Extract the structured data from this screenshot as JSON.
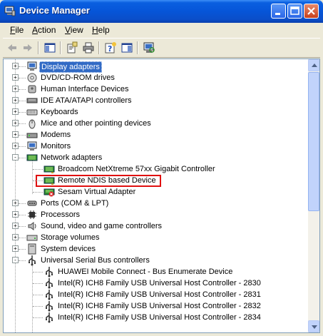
{
  "window": {
    "title": "Device Manager"
  },
  "menu": [
    {
      "label": "File",
      "u": "F",
      "rest": "ile"
    },
    {
      "label": "Action",
      "u": "A",
      "rest": "ction"
    },
    {
      "label": "View",
      "u": "V",
      "rest": "iew"
    },
    {
      "label": "Help",
      "u": "H",
      "rest": "elp"
    }
  ],
  "toolbar": {
    "icons": [
      "back-arrow-icon",
      "forward-arrow-icon",
      "show-hide-tree-icon",
      "properties-icon",
      "print-icon",
      "help-icon",
      "show-hide-action-pane-icon",
      "scan-hardware-icon"
    ]
  },
  "tree": {
    "items": [
      {
        "label": "Display adapters",
        "expander": "+",
        "selected": true
      },
      {
        "label": "DVD/CD-ROM drives",
        "expander": "+"
      },
      {
        "label": "Human Interface Devices",
        "expander": "+"
      },
      {
        "label": "IDE ATA/ATAPI controllers",
        "expander": "+"
      },
      {
        "label": "Keyboards",
        "expander": "+"
      },
      {
        "label": "Mice and other pointing devices",
        "expander": "+"
      },
      {
        "label": "Modems",
        "expander": "+"
      },
      {
        "label": "Monitors",
        "expander": "+"
      },
      {
        "label": "Network adapters",
        "expander": "-"
      },
      {
        "label": "Broadcom NetXtreme 57xx Gigabit Controller",
        "child": true
      },
      {
        "label": "Remote NDIS based Device",
        "child": true,
        "highlighted": true
      },
      {
        "label": "Sesam Virtual Adapter",
        "child": true
      },
      {
        "label": "Ports (COM & LPT)",
        "expander": "+"
      },
      {
        "label": "Processors",
        "expander": "+"
      },
      {
        "label": "Sound, video and game controllers",
        "expander": "+"
      },
      {
        "label": "Storage volumes",
        "expander": "+"
      },
      {
        "label": "System devices",
        "expander": "+"
      },
      {
        "label": "Universal Serial Bus controllers",
        "expander": "-"
      },
      {
        "label": "HUAWEI Mobile Connect - Bus Enumerate Device",
        "child": true
      },
      {
        "label": "Intel(R) ICH8 Family USB Universal Host Controller - 2830",
        "child": true
      },
      {
        "label": "Intel(R) ICH8 Family USB Universal Host Controller - 2831",
        "child": true
      },
      {
        "label": "Intel(R) ICH8 Family USB Universal Host Controller - 2832",
        "child": true
      },
      {
        "label": "Intel(R) ICH8 Family USB Universal Host Controller - 2834",
        "child": true
      }
    ]
  }
}
